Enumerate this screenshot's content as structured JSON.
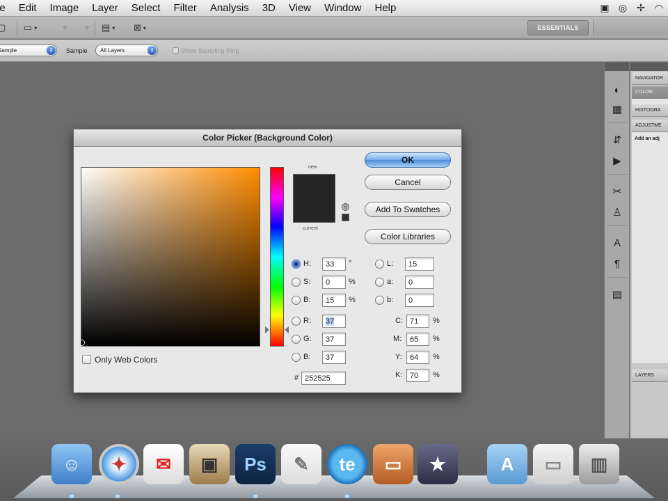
{
  "menubar": {
    "items": [
      "le",
      "Edit",
      "Image",
      "Layer",
      "Select",
      "Filter",
      "Analysis",
      "3D",
      "View",
      "Window",
      "Help"
    ]
  },
  "appbar": {
    "workspace": "ESSENTIALS"
  },
  "options": {
    "sample_size_value": "Sample",
    "sample_label": "Sample",
    "sample_value": "All Layers",
    "sampling_ring_label": "Show Sampling Ring"
  },
  "panels": {
    "navigator": "NAVIGATOR",
    "color": "COLOR",
    "histogram": "HISTOGRA",
    "adjustments": "ADJUSTME",
    "add_adjustment": "Add an adj",
    "layers": "LAYERS"
  },
  "dialog": {
    "title": "Color Picker (Background Color)",
    "ok": "OK",
    "cancel": "Cancel",
    "add_swatches": "Add To Swatches",
    "color_libraries": "Color Libraries",
    "new_label": "new",
    "current_label": "current",
    "only_web_colors": "Only Web Colors",
    "fields": {
      "h": {
        "label": "H:",
        "value": "33",
        "unit": "°"
      },
      "s": {
        "label": "S:",
        "value": "0",
        "unit": "%"
      },
      "b": {
        "label": "B:",
        "value": "15",
        "unit": "%"
      },
      "r": {
        "label": "R:",
        "value": "37"
      },
      "g": {
        "label": "G:",
        "value": "37"
      },
      "bl": {
        "label": "B:",
        "value": "37"
      },
      "l": {
        "label": "L:",
        "value": "15"
      },
      "a": {
        "label": "a:",
        "value": "0"
      },
      "lb": {
        "label": "b:",
        "value": "0"
      },
      "c": {
        "label": "C:",
        "value": "71",
        "unit": "%"
      },
      "m": {
        "label": "M:",
        "value": "65",
        "unit": "%"
      },
      "y": {
        "label": "Y:",
        "value": "64",
        "unit": "%"
      },
      "k": {
        "label": "K:",
        "value": "70",
        "unit": "%"
      },
      "hex_label": "#",
      "hex": "252525"
    },
    "current_color": "#252525"
  },
  "dock": {
    "photoshop_label": "Ps",
    "app_label": "te"
  }
}
